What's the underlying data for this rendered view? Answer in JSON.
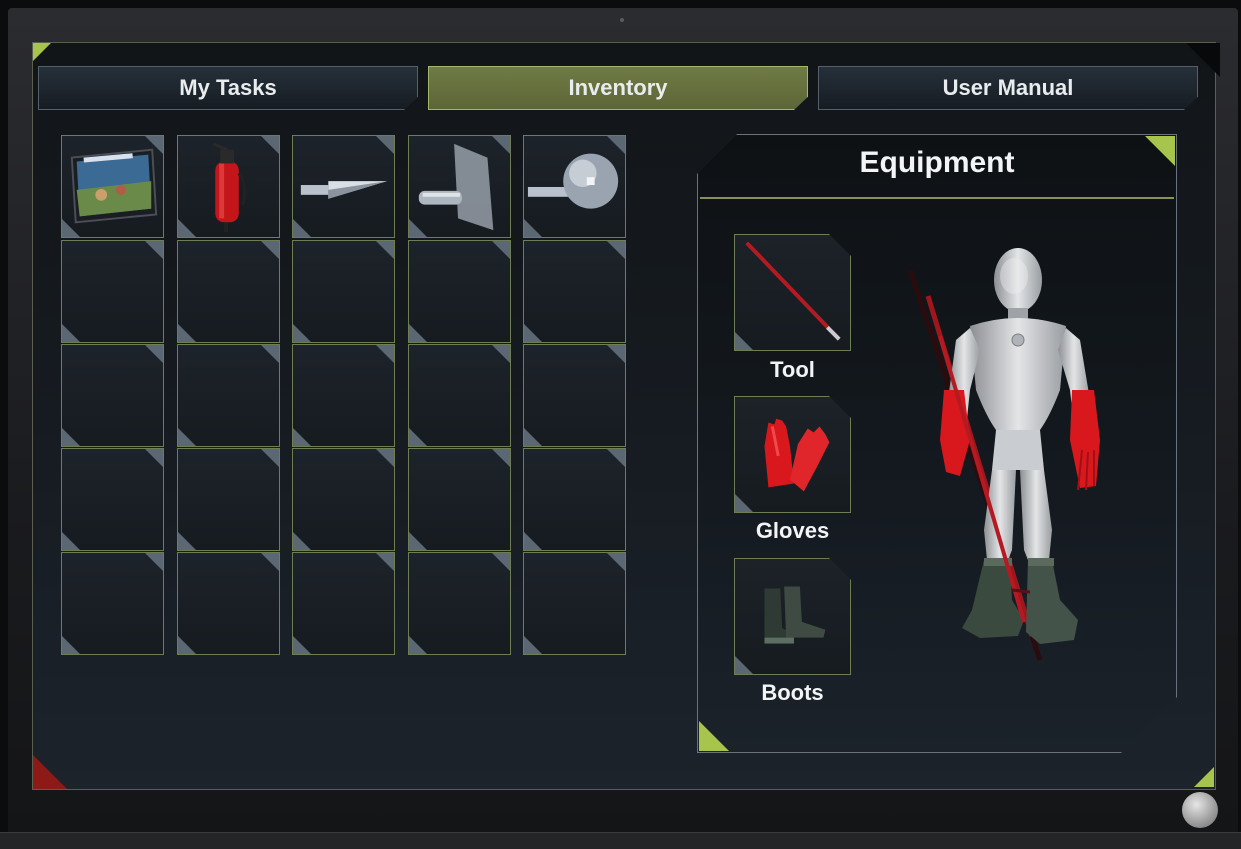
{
  "tabs": [
    {
      "label": "My Tasks",
      "active": false
    },
    {
      "label": "Inventory",
      "active": true
    },
    {
      "label": "User Manual",
      "active": false
    }
  ],
  "inventory": {
    "columns": 5,
    "rows": 5,
    "items": [
      "tablet-icon",
      "fire-extinguisher-icon",
      "probe-tip-icon",
      "plate-probe-icon",
      "sphere-probe-icon"
    ]
  },
  "equipment": {
    "title": "Equipment",
    "slots": [
      {
        "label": "Tool",
        "icon": "hot-stick-icon"
      },
      {
        "label": "Gloves",
        "icon": "gloves-icon"
      },
      {
        "label": "Boots",
        "icon": "boots-icon"
      }
    ]
  },
  "colors": {
    "accent": "#a7c44c",
    "active_tab": "#6f7b45",
    "alert_corner": "#8e1a18",
    "gloves_red": "#d8181c"
  }
}
